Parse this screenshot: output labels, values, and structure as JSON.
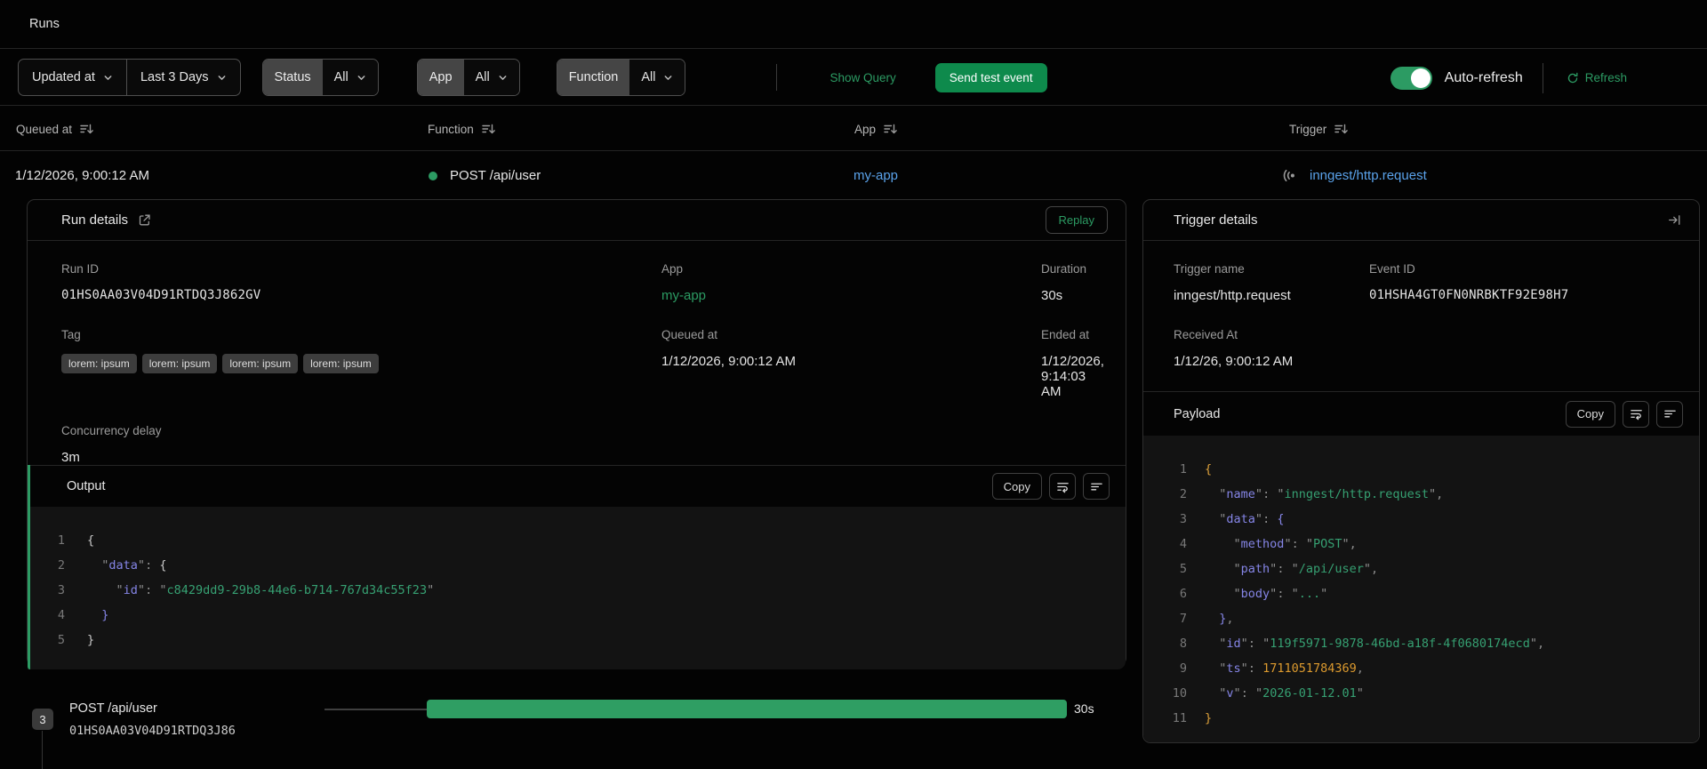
{
  "page": {
    "title": "Runs"
  },
  "filters": {
    "sort_field": {
      "label": "Updated at"
    },
    "time_range": {
      "label": "Last 3 Days"
    },
    "status": {
      "label": "Status",
      "value": "All"
    },
    "app": {
      "label": "App",
      "value": "All"
    },
    "function": {
      "label": "Function",
      "value": "All"
    },
    "show_query_label": "Show Query",
    "send_test_event_label": "Send test event",
    "auto_refresh": {
      "label": "Auto-refresh",
      "enabled": true
    },
    "refresh_label": "Refresh"
  },
  "table": {
    "headers": [
      "Queued at",
      "Function",
      "App",
      "Trigger"
    ],
    "row": {
      "queued_at": "1/12/2026, 9:00:12 AM",
      "function": "POST /api/user",
      "app": "my-app",
      "trigger": "inngest/http.request"
    }
  },
  "run_details": {
    "title": "Run details",
    "replay_label": "Replay",
    "run_id": {
      "label": "Run ID",
      "value": "01HS0AA03V04D91RTDQ3J862GV"
    },
    "app": {
      "label": "App",
      "value": "my-app"
    },
    "duration": {
      "label": "Duration",
      "value": "30s"
    },
    "tag": {
      "label": "Tag",
      "values": [
        "lorem: ipsum",
        "lorem: ipsum",
        "lorem: ipsum",
        "lorem: ipsum"
      ]
    },
    "queued_at": {
      "label": "Queued at",
      "value": "1/12/2026, 9:00:12 AM"
    },
    "ended_at": {
      "label": "Ended at",
      "value": "1/12/2026, 9:14:03 AM"
    },
    "concurrency_delay": {
      "label": "Concurrency delay",
      "value": "3m"
    },
    "output": {
      "title": "Output",
      "copy_label": "Copy",
      "lines": [
        [
          [
            "{",
            "p"
          ]
        ],
        [
          [
            "  ",
            "p"
          ],
          [
            "\"",
            "q"
          ],
          [
            "data",
            "k"
          ],
          [
            "\"",
            "q"
          ],
          [
            ": ",
            "u"
          ],
          [
            "{",
            "p"
          ]
        ],
        [
          [
            "    ",
            "p"
          ],
          [
            "\"",
            "q"
          ],
          [
            "id",
            "k"
          ],
          [
            "\"",
            "q"
          ],
          [
            ": ",
            "u"
          ],
          [
            "\"",
            "q"
          ],
          [
            "c8429dd9-29b8-44e6-b714-767d34c55f23",
            "s"
          ],
          [
            "\"",
            "q"
          ]
        ],
        [
          [
            "  ",
            "p"
          ],
          [
            "}",
            "v"
          ]
        ],
        [
          [
            "}",
            "p"
          ]
        ]
      ]
    }
  },
  "trigger_details": {
    "title": "Trigger details",
    "trigger_name": {
      "label": "Trigger name",
      "value": "inngest/http.request"
    },
    "event_id": {
      "label": "Event ID",
      "value": "01HSHA4GT0FN0NRBKTF92E98H7"
    },
    "received_at": {
      "label": "Received At",
      "value": "1/12/26, 9:00:12 AM"
    },
    "payload": {
      "title": "Payload",
      "copy_label": "Copy",
      "lines": [
        [
          [
            "{",
            "o"
          ]
        ],
        [
          [
            "  ",
            "p"
          ],
          [
            "\"",
            "q"
          ],
          [
            "name",
            "k"
          ],
          [
            "\"",
            "q"
          ],
          [
            ": ",
            "u"
          ],
          [
            "\"",
            "q"
          ],
          [
            "inngest/http.request",
            "s"
          ],
          [
            "\"",
            "q"
          ],
          [
            ",",
            "u"
          ]
        ],
        [
          [
            "  ",
            "p"
          ],
          [
            "\"",
            "q"
          ],
          [
            "data",
            "k"
          ],
          [
            "\"",
            "q"
          ],
          [
            ": ",
            "u"
          ],
          [
            "{",
            "v"
          ]
        ],
        [
          [
            "    ",
            "p"
          ],
          [
            "\"",
            "q"
          ],
          [
            "method",
            "k"
          ],
          [
            "\"",
            "q"
          ],
          [
            ": ",
            "u"
          ],
          [
            "\"",
            "q"
          ],
          [
            "POST",
            "s"
          ],
          [
            "\"",
            "q"
          ],
          [
            ",",
            "u"
          ]
        ],
        [
          [
            "    ",
            "p"
          ],
          [
            "\"",
            "q"
          ],
          [
            "path",
            "k"
          ],
          [
            "\"",
            "q"
          ],
          [
            ": ",
            "u"
          ],
          [
            "\"",
            "q"
          ],
          [
            "/api/user",
            "s"
          ],
          [
            "\"",
            "q"
          ],
          [
            ",",
            "u"
          ]
        ],
        [
          [
            "    ",
            "p"
          ],
          [
            "\"",
            "q"
          ],
          [
            "body",
            "k"
          ],
          [
            "\"",
            "q"
          ],
          [
            ": ",
            "u"
          ],
          [
            "\"",
            "q"
          ],
          [
            "...",
            "s"
          ],
          [
            "\"",
            "q"
          ]
        ],
        [
          [
            "  ",
            "p"
          ],
          [
            "}",
            "v"
          ],
          [
            ",",
            "u"
          ]
        ],
        [
          [
            "  ",
            "p"
          ],
          [
            "\"",
            "q"
          ],
          [
            "id",
            "k"
          ],
          [
            "\"",
            "q"
          ],
          [
            ": ",
            "u"
          ],
          [
            "\"",
            "q"
          ],
          [
            "119f5971-9878-46bd-a18f-4f0680174ecd",
            "s"
          ],
          [
            "\"",
            "q"
          ],
          [
            ",",
            "u"
          ]
        ],
        [
          [
            "  ",
            "p"
          ],
          [
            "\"",
            "q"
          ],
          [
            "ts",
            "k"
          ],
          [
            "\"",
            "q"
          ],
          [
            ": ",
            "u"
          ],
          [
            "1711051784369",
            "n"
          ],
          [
            ",",
            "u"
          ]
        ],
        [
          [
            "  ",
            "p"
          ],
          [
            "\"",
            "q"
          ],
          [
            "v",
            "k"
          ],
          [
            "\"",
            "q"
          ],
          [
            ": ",
            "u"
          ],
          [
            "\"",
            "q"
          ],
          [
            "2026-01-12.01",
            "s"
          ],
          [
            "\"",
            "q"
          ]
        ],
        [
          [
            "}",
            "o"
          ]
        ]
      ]
    }
  },
  "timeline": {
    "step_count": "3",
    "function_name": "POST /api/user",
    "run_id": "01HS0AA03V04D91RTDQ3J86",
    "duration": "30s"
  },
  "colors": {
    "accent_green": "#2c9b63",
    "button_green": "#0e8a4c",
    "bar_green": "#2f9e63",
    "link_blue": "#5aa2ea",
    "code_key": "#8585e6",
    "code_string": "#36a072",
    "code_number": "#dc9a2e",
    "code_bracket_orange": "#dca03a",
    "code_bracket_purple": "#8585e6"
  }
}
